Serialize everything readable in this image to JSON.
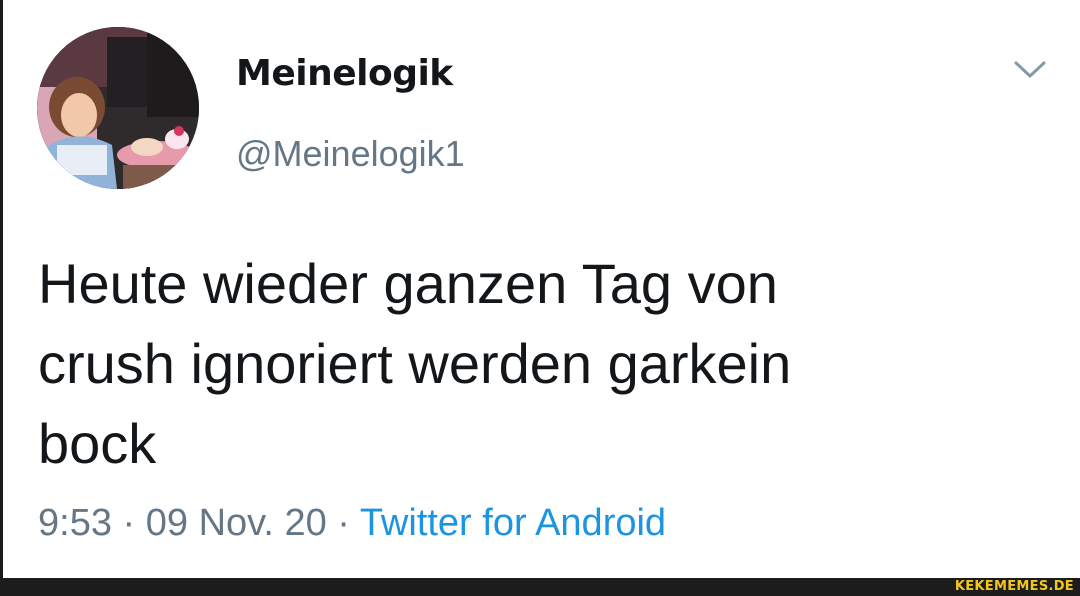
{
  "tweet": {
    "display_name": "Meinelogik",
    "handle": "@Meinelogik1",
    "text": "Heute wieder ganzen Tag von\ncrush ignoriert werden garkein\nbock",
    "time": "9:53",
    "separator": " · ",
    "date": "09 Nov. 20",
    "source": "Twitter for Android",
    "menu_icon": "chevron-down-icon",
    "avatar_icon": "profile-avatar"
  },
  "colors": {
    "text": "#14171a",
    "secondary": "#657786",
    "link": "#1b95e0",
    "chevron": "#8899a6",
    "watermark": "#f2c61f"
  },
  "watermark": {
    "text": "KEKEMEMES.DE"
  }
}
